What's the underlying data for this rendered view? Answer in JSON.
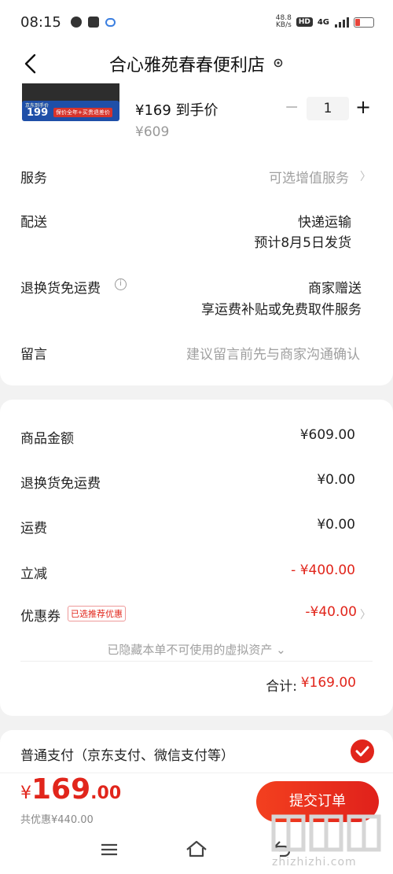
{
  "status": {
    "time": "08:15",
    "net_speed_top": "48.8",
    "net_speed_bottom": "KB/s",
    "hd": "HD",
    "network": "4G"
  },
  "nav": {
    "title": "合心雅苑春春便利店"
  },
  "product": {
    "banner_tag": "京东到手价",
    "banner_num": "199",
    "banner_text": "保价全年+买贵退差价",
    "price": "¥169 到手价",
    "original_price": "¥609",
    "quantity": "1",
    "minus": "−",
    "plus": "+"
  },
  "rows": {
    "service_label": "服务",
    "service_value": "可选增值服务",
    "delivery_label": "配送",
    "delivery_value": "快递运输",
    "delivery_date": "预计8月5日发货",
    "return_label": "退换货免运费",
    "return_value": "商家赠送",
    "return_detail": "享运费补贴或免费取件服务",
    "note_label": "留言",
    "note_placeholder": "建议留言前先与商家沟通确认"
  },
  "summary": {
    "items": [
      {
        "label": "商品金额",
        "value": "¥609.00"
      },
      {
        "label": "退换货免运费",
        "value": "¥0.00"
      },
      {
        "label": "运费",
        "value": "¥0.00"
      },
      {
        "label": "立减",
        "value": "- ¥400.00"
      },
      {
        "label": "优惠券",
        "value": "-¥40.00"
      }
    ],
    "coupon_tag": "已选推荐优惠",
    "hidden_assets": "已隐藏本单不可使用的虚拟资产 ⌄",
    "total_label": "合计:",
    "total_value": "¥169.00"
  },
  "payment": {
    "label": "普通支付（京东支付、微信支付等）"
  },
  "footer": {
    "currency": "¥",
    "price_int": "169",
    "price_dec": ".00",
    "saved": "共优惠¥440.00",
    "submit": "提交订单"
  },
  "watermark": {
    "text": "zhizhizhi.com"
  },
  "colors": {
    "accent": "#e1251b"
  }
}
